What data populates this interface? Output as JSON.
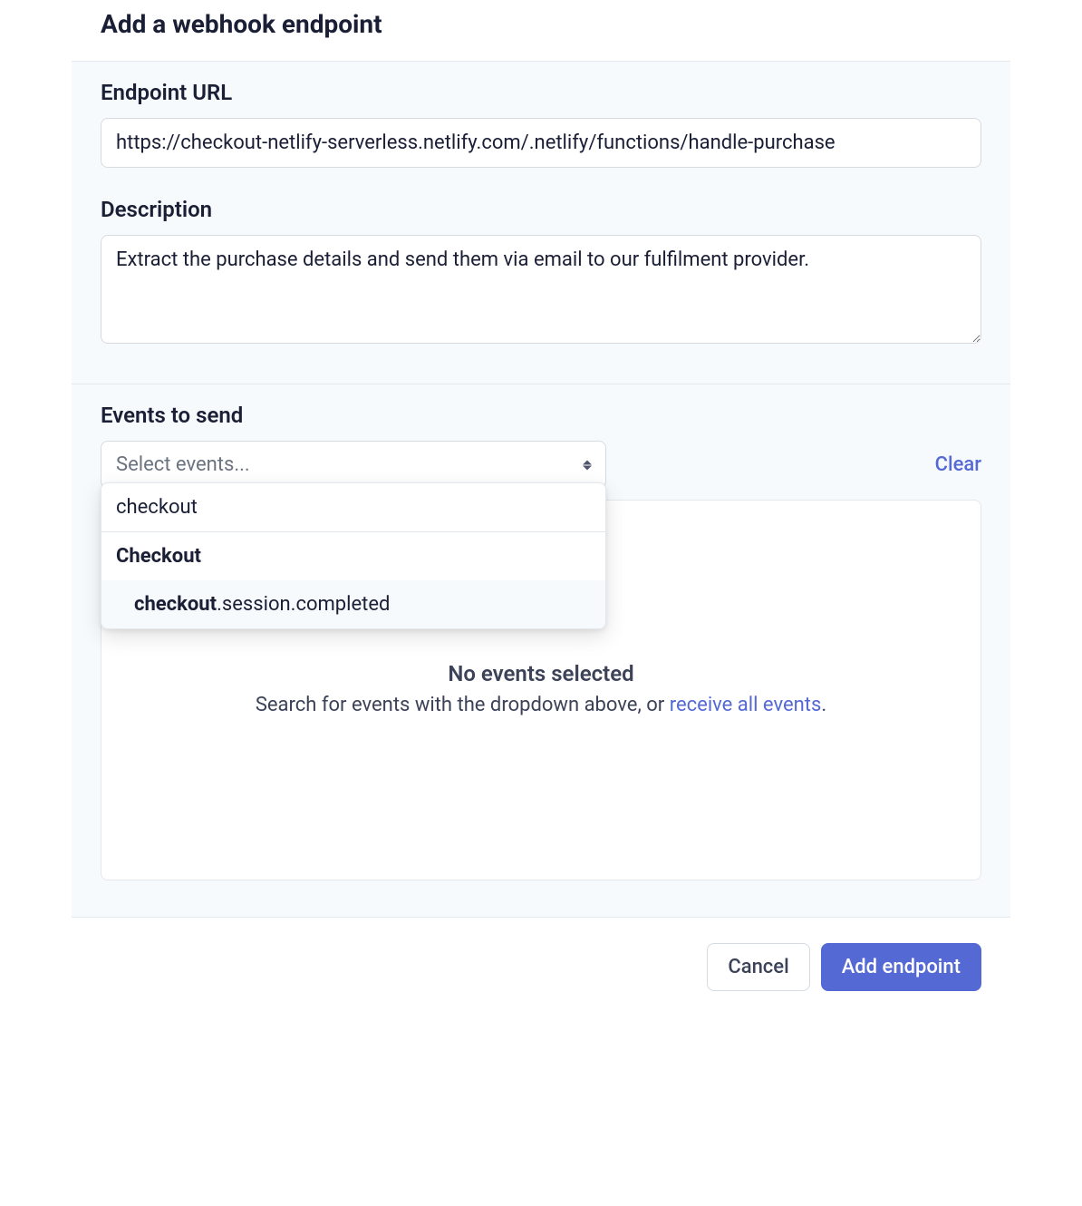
{
  "header": {
    "title": "Add a webhook endpoint"
  },
  "form": {
    "url_label": "Endpoint URL",
    "url_value": "https://checkout-netlify-serverless.netlify.com/.netlify/functions/handle-purchase",
    "description_label": "Description",
    "description_value": "Extract the purchase details and send them via email to our fulfilment provider."
  },
  "events": {
    "label": "Events to send",
    "select_placeholder": "Select events...",
    "clear_label": "Clear",
    "dropdown": {
      "search_value": "checkout",
      "group_header": "Checkout",
      "option_bold": "checkout",
      "option_rest": ".session.completed"
    },
    "empty": {
      "title": "No events selected",
      "desc_prefix": "Search for events with the dropdown above, or ",
      "desc_link": "receive all events",
      "desc_suffix": "."
    }
  },
  "footer": {
    "cancel_label": "Cancel",
    "submit_label": "Add endpoint"
  }
}
